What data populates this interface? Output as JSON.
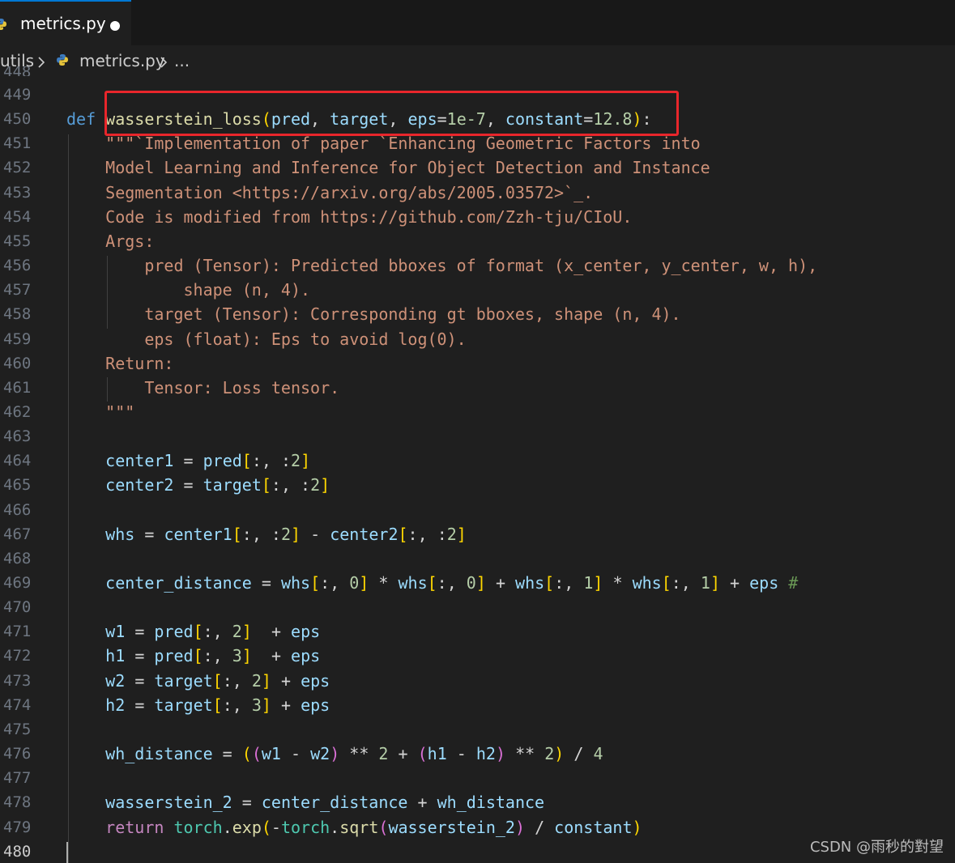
{
  "tab": {
    "title": "metrics.py",
    "file_icon": "python-icon",
    "dirty_indicator": "unsaved-dot-icon"
  },
  "breadcrumb": {
    "folder": "utils",
    "file": "metrics.py",
    "more": "..."
  },
  "editor": {
    "cut_line_number": "448",
    "lines": [
      {
        "n": "449",
        "text": ""
      },
      {
        "n": "450",
        "text": "def wasserstein_loss(pred, target, eps=1e-7, constant=12.8):"
      },
      {
        "n": "451",
        "text": "    \"\"\"`Implementation of paper `Enhancing Geometric Factors into"
      },
      {
        "n": "452",
        "text": "    Model Learning and Inference for Object Detection and Instance"
      },
      {
        "n": "453",
        "text": "    Segmentation <https://arxiv.org/abs/2005.03572>`_."
      },
      {
        "n": "454",
        "text": "    Code is modified from https://github.com/Zzh-tju/CIoU."
      },
      {
        "n": "455",
        "text": "    Args:"
      },
      {
        "n": "456",
        "text": "        pred (Tensor): Predicted bboxes of format (x_center, y_center, w, h),"
      },
      {
        "n": "457",
        "text": "            shape (n, 4)."
      },
      {
        "n": "458",
        "text": "        target (Tensor): Corresponding gt bboxes, shape (n, 4)."
      },
      {
        "n": "459",
        "text": "        eps (float): Eps to avoid log(0)."
      },
      {
        "n": "460",
        "text": "    Return:"
      },
      {
        "n": "461",
        "text": "        Tensor: Loss tensor."
      },
      {
        "n": "462",
        "text": "    \"\"\""
      },
      {
        "n": "463",
        "text": ""
      },
      {
        "n": "464",
        "text": "    center1 = pred[:, :2]"
      },
      {
        "n": "465",
        "text": "    center2 = target[:, :2]"
      },
      {
        "n": "466",
        "text": ""
      },
      {
        "n": "467",
        "text": "    whs = center1[:, :2] - center2[:, :2]"
      },
      {
        "n": "468",
        "text": ""
      },
      {
        "n": "469",
        "text": "    center_distance = whs[:, 0] * whs[:, 0] + whs[:, 1] * whs[:, 1] + eps #"
      },
      {
        "n": "470",
        "text": ""
      },
      {
        "n": "471",
        "text": "    w1 = pred[:, 2]  + eps"
      },
      {
        "n": "472",
        "text": "    h1 = pred[:, 3]  + eps"
      },
      {
        "n": "473",
        "text": "    w2 = target[:, 2] + eps"
      },
      {
        "n": "474",
        "text": "    h2 = target[:, 3] + eps"
      },
      {
        "n": "475",
        "text": ""
      },
      {
        "n": "476",
        "text": "    wh_distance = ((w1 - w2) ** 2 + (h1 - h2) ** 2) / 4"
      },
      {
        "n": "477",
        "text": ""
      },
      {
        "n": "478",
        "text": "    wasserstein_2 = center_distance + wh_distance"
      },
      {
        "n": "479",
        "text": "    return torch.exp(-torch.sqrt(wasserstein_2) / constant)"
      },
      {
        "n": "480",
        "text": ""
      }
    ]
  },
  "annotation": {
    "box_color": "#e8262b"
  },
  "watermark": "CSDN @雨秒的對望"
}
